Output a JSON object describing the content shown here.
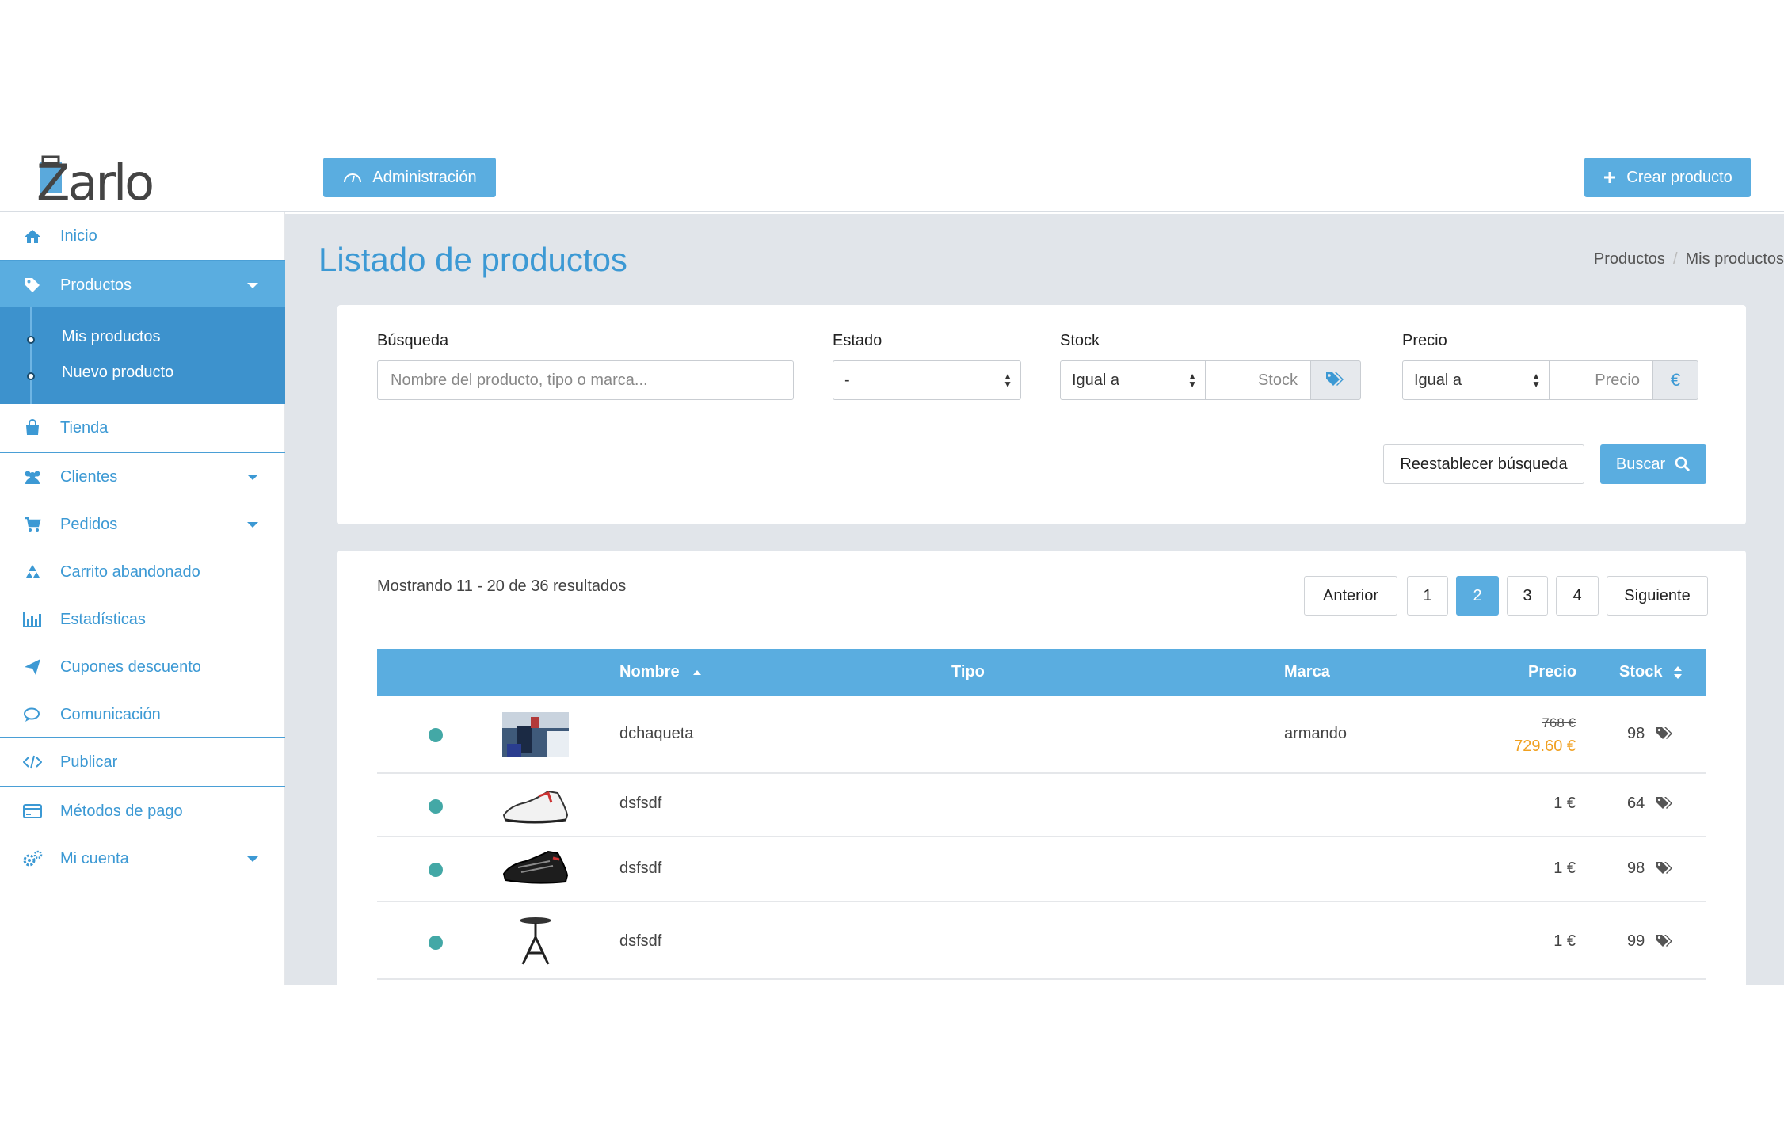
{
  "header": {
    "logo_text": "Zarlo",
    "admin_label": "Administración",
    "create_label": "Crear producto"
  },
  "sidebar": {
    "items": [
      {
        "label": "Inicio",
        "icon": "home-icon"
      },
      {
        "label": "Productos",
        "icon": "tag-icon"
      },
      {
        "label": "Tienda",
        "icon": "shopping-bag-icon"
      },
      {
        "label": "Clientes",
        "icon": "users-icon"
      },
      {
        "label": "Pedidos",
        "icon": "cart-icon"
      },
      {
        "label": "Carrito abandonado",
        "icon": "recycle-icon"
      },
      {
        "label": "Estadísticas",
        "icon": "bar-chart-icon"
      },
      {
        "label": "Cupones descuento",
        "icon": "paper-plane-icon"
      },
      {
        "label": "Comunicación",
        "icon": "chat-icon"
      },
      {
        "label": "Publicar",
        "icon": "code-icon"
      },
      {
        "label": "Métodos de pago",
        "icon": "credit-card-icon"
      },
      {
        "label": "Mi cuenta",
        "icon": "gears-icon"
      }
    ],
    "submenu": [
      "Mis productos",
      "Nuevo producto"
    ]
  },
  "page": {
    "title": "Listado de productos",
    "breadcrumb": [
      "Productos",
      "Mis productos"
    ]
  },
  "filters": {
    "search_label": "Búsqueda",
    "search_placeholder": "Nombre del producto, tipo o marca...",
    "estado_label": "Estado",
    "estado_value": "-",
    "stock_label": "Stock",
    "stock_op": "Igual a",
    "stock_placeholder": "Stock",
    "precio_label": "Precio",
    "precio_op": "Igual a",
    "precio_placeholder": "Precio",
    "euro_symbol": "€",
    "reset_label": "Reestablecer búsqueda",
    "search_button": "Buscar"
  },
  "results": {
    "summary": "Mostrando 11 - 20 de 36 resultados",
    "prev": "Anterior",
    "next": "Siguiente",
    "pages": [
      "1",
      "2",
      "3",
      "4"
    ],
    "active_page": "2",
    "columns": {
      "nombre": "Nombre",
      "tipo": "Tipo",
      "marca": "Marca",
      "precio": "Precio",
      "stock": "Stock"
    },
    "rows": [
      {
        "nombre": "dchaqueta",
        "tipo": "",
        "marca": "armando",
        "precio_old": "768 €",
        "precio": "729.60 €",
        "stock": "98",
        "thumb": "photo"
      },
      {
        "nombre": "dsfsdf",
        "tipo": "",
        "marca": "",
        "precio_old": "",
        "precio": "1 €",
        "stock": "64",
        "thumb": "white-shoe"
      },
      {
        "nombre": "dsfsdf",
        "tipo": "",
        "marca": "",
        "precio_old": "",
        "precio": "1 €",
        "stock": "98",
        "thumb": "black-shoe"
      },
      {
        "nombre": "dsfsdf",
        "tipo": "",
        "marca": "",
        "precio_old": "",
        "precio": "1 €",
        "stock": "99",
        "thumb": "stool"
      }
    ]
  },
  "colors": {
    "accent": "#5aade0",
    "link": "#3c99d4",
    "sale_price": "#f0a020",
    "status_dot": "#43a8a6"
  }
}
